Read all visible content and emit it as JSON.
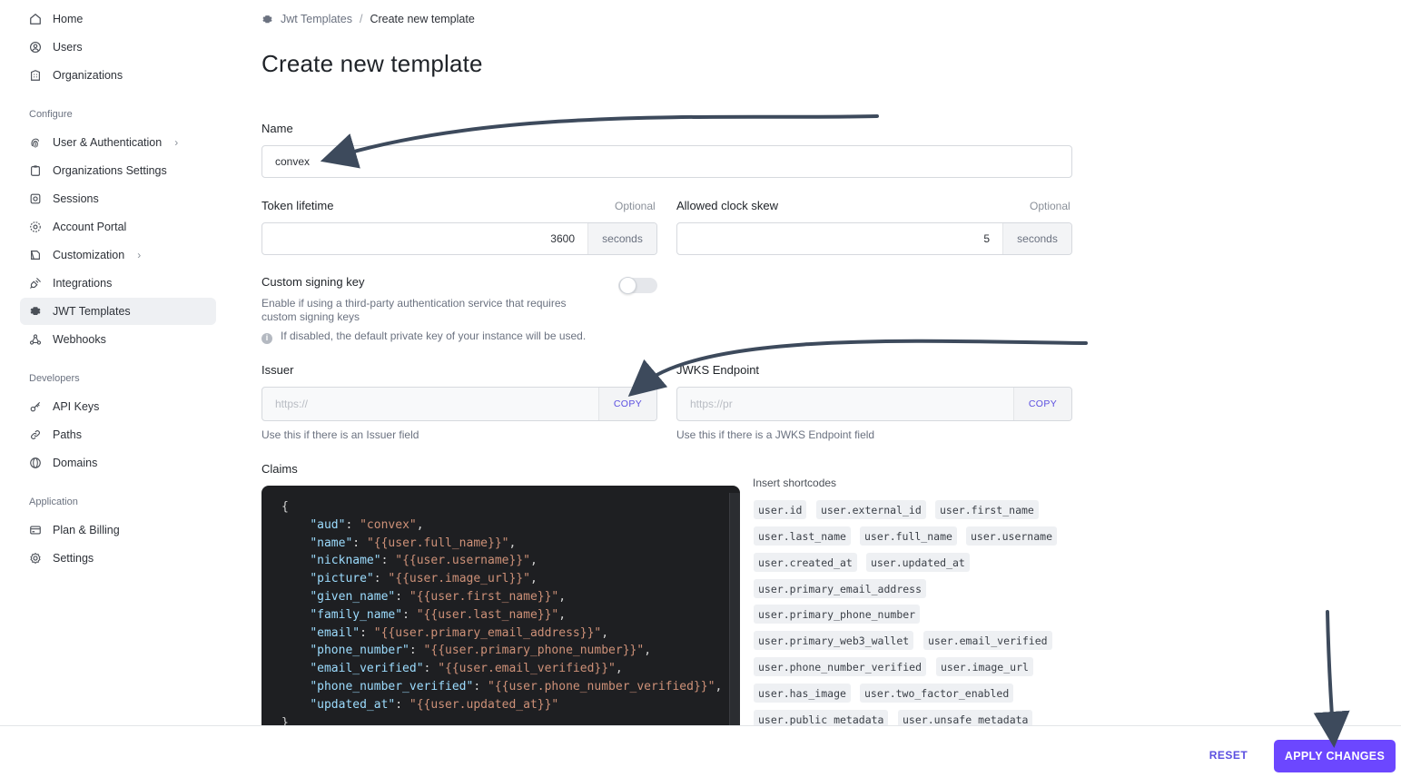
{
  "sidebar": {
    "top_items": [
      {
        "label": "Home",
        "icon": "home-icon"
      },
      {
        "label": "Users",
        "icon": "user-circle-icon"
      },
      {
        "label": "Organizations",
        "icon": "building-icon"
      }
    ],
    "sections": [
      {
        "title": "Configure",
        "items": [
          {
            "label": "User & Authentication",
            "icon": "fingerprint-icon",
            "chevron": true
          },
          {
            "label": "Organizations Settings",
            "icon": "clipboard-icon"
          },
          {
            "label": "Sessions",
            "icon": "sessions-icon"
          },
          {
            "label": "Account Portal",
            "icon": "portal-icon"
          },
          {
            "label": "Customization",
            "icon": "palette-icon",
            "chevron": true
          },
          {
            "label": "Integrations",
            "icon": "plug-icon"
          },
          {
            "label": "JWT Templates",
            "icon": "gear-icon",
            "active": true
          },
          {
            "label": "Webhooks",
            "icon": "webhook-icon"
          }
        ]
      },
      {
        "title": "Developers",
        "items": [
          {
            "label": "API Keys",
            "icon": "key-icon"
          },
          {
            "label": "Paths",
            "icon": "link-icon"
          },
          {
            "label": "Domains",
            "icon": "globe-icon"
          }
        ]
      },
      {
        "title": "Application",
        "items": [
          {
            "label": "Plan & Billing",
            "icon": "credit-card-icon"
          },
          {
            "label": "Settings",
            "icon": "settings-icon"
          }
        ]
      }
    ]
  },
  "breadcrumb": {
    "parent": "Jwt Templates",
    "separator": "/",
    "current": "Create new template"
  },
  "page_title": "Create new template",
  "form": {
    "name": {
      "label": "Name",
      "value": "convex"
    },
    "token_lifetime": {
      "label": "Token lifetime",
      "optional": "Optional",
      "value": "3600",
      "unit": "seconds"
    },
    "clock_skew": {
      "label": "Allowed clock skew",
      "optional": "Optional",
      "value": "5",
      "unit": "seconds"
    },
    "signing_key": {
      "label": "Custom signing key",
      "description": "Enable if using a third-party authentication service that requires custom signing keys",
      "note": "If disabled, the default private key of your instance will be used.",
      "enabled": false
    },
    "issuer": {
      "label": "Issuer",
      "value": "https://",
      "copy": "COPY",
      "help": "Use this if there is an Issuer field"
    },
    "jwks": {
      "label": "JWKS Endpoint",
      "value": "https://pr",
      "copy": "COPY",
      "help": "Use this if there is a JWKS Endpoint field"
    },
    "claims": {
      "label": "Claims",
      "entries": [
        {
          "key": "aud",
          "value": "convex"
        },
        {
          "key": "name",
          "value": "{{user.full_name}}"
        },
        {
          "key": "nickname",
          "value": "{{user.username}}"
        },
        {
          "key": "picture",
          "value": "{{user.image_url}}"
        },
        {
          "key": "given_name",
          "value": "{{user.first_name}}"
        },
        {
          "key": "family_name",
          "value": "{{user.last_name}}"
        },
        {
          "key": "email",
          "value": "{{user.primary_email_address}}"
        },
        {
          "key": "phone_number",
          "value": "{{user.primary_phone_number}}"
        },
        {
          "key": "email_verified",
          "value": "{{user.email_verified}}"
        },
        {
          "key": "phone_number_verified",
          "value": "{{user.phone_number_verified}}"
        },
        {
          "key": "updated_at",
          "value": "{{user.updated_at}}"
        }
      ]
    }
  },
  "shortcodes": {
    "title": "Insert shortcodes",
    "rows": [
      [
        "user.id",
        "user.external_id",
        "user.first_name"
      ],
      [
        "user.last_name",
        "user.full_name",
        "user.username"
      ],
      [
        "user.created_at",
        "user.updated_at"
      ],
      [
        "user.primary_email_address"
      ],
      [
        "user.primary_phone_number"
      ],
      [
        "user.primary_web3_wallet",
        "user.email_verified"
      ],
      [
        "user.phone_number_verified",
        "user.image_url"
      ],
      [
        "user.has_image",
        "user.two_factor_enabled"
      ],
      [
        "user.public_metadata",
        "user.unsafe_metadata"
      ]
    ]
  },
  "footer": {
    "reset": "RESET",
    "apply": "APPLY CHANGES"
  },
  "colors": {
    "accent": "#6c47ff",
    "link": "#5b4fe0",
    "editor_bg": "#1e1f22",
    "annotation_arrow": "#3d4a5c"
  }
}
